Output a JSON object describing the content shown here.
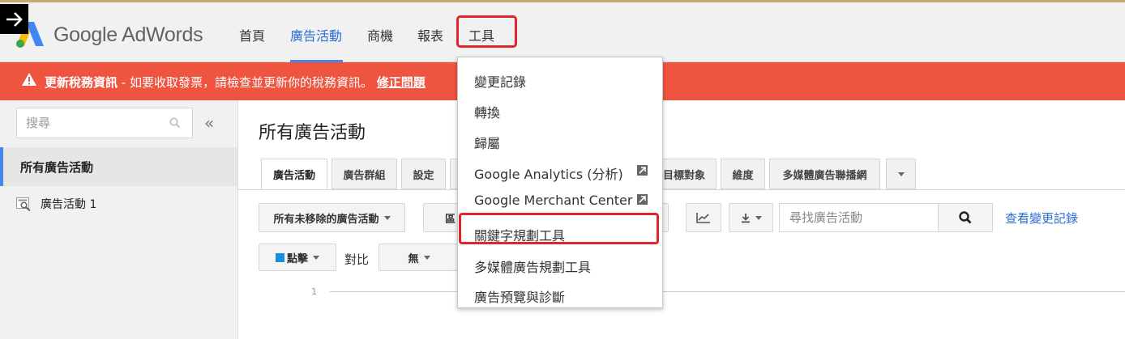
{
  "header": {
    "brand": "Google AdWords",
    "nav": [
      {
        "label": "首頁",
        "active": false
      },
      {
        "label": "廣告活動",
        "active": true
      },
      {
        "label": "商機",
        "active": false
      },
      {
        "label": "報表",
        "active": false
      },
      {
        "label": "工具",
        "active": false,
        "highlighted": true
      }
    ]
  },
  "alert": {
    "title": "更新稅務資訊",
    "message": " - 如要收取發票，請檢查並更新你的稅務資訊。",
    "link": "修正問題"
  },
  "sidebar": {
    "search_placeholder": "搜尋",
    "collapse_glyph": "«",
    "all_campaigns": "所有廣告活動",
    "campaigns": [
      {
        "label": "廣告活動 1"
      }
    ]
  },
  "main": {
    "title": "所有廣告活動",
    "tabs": [
      {
        "label": "廣告活動",
        "active": true
      },
      {
        "label": "廣告群組",
        "active": false
      },
      {
        "label": "設定",
        "active": false
      },
      {
        "label": "目標對象",
        "active": false
      },
      {
        "label": "維度",
        "active": false
      },
      {
        "label": "多媒體廣告聯播網",
        "active": false
      }
    ],
    "filter_label": "所有未移除的廣告活動",
    "partial_button": "區",
    "find_placeholder": "尋找廣告活動",
    "view_history": "查看變更記錄",
    "metric_label": "點擊",
    "compare_label": "對比",
    "compare_value": "無",
    "chart_axis_value": "1"
  },
  "tools_menu": {
    "items": [
      {
        "label": "變更記錄",
        "external": false
      },
      {
        "label": "轉換",
        "external": false
      },
      {
        "label": "歸屬",
        "external": false
      },
      {
        "label": "Google Analytics (分析)",
        "external": true
      },
      {
        "label": "Google Merchant Center",
        "external": true
      },
      {
        "label": "關鍵字規劃工具",
        "external": false,
        "highlighted": true
      },
      {
        "label": "多媒體廣告規劃工具",
        "external": false
      },
      {
        "label": "廣告預覽與診斷",
        "external": false
      }
    ]
  },
  "colors": {
    "alert_bg": "#ef5441",
    "accent_blue": "#4a86e8",
    "highlight_red": "#e0262b",
    "metric_swatch": "#1a8ce0"
  }
}
